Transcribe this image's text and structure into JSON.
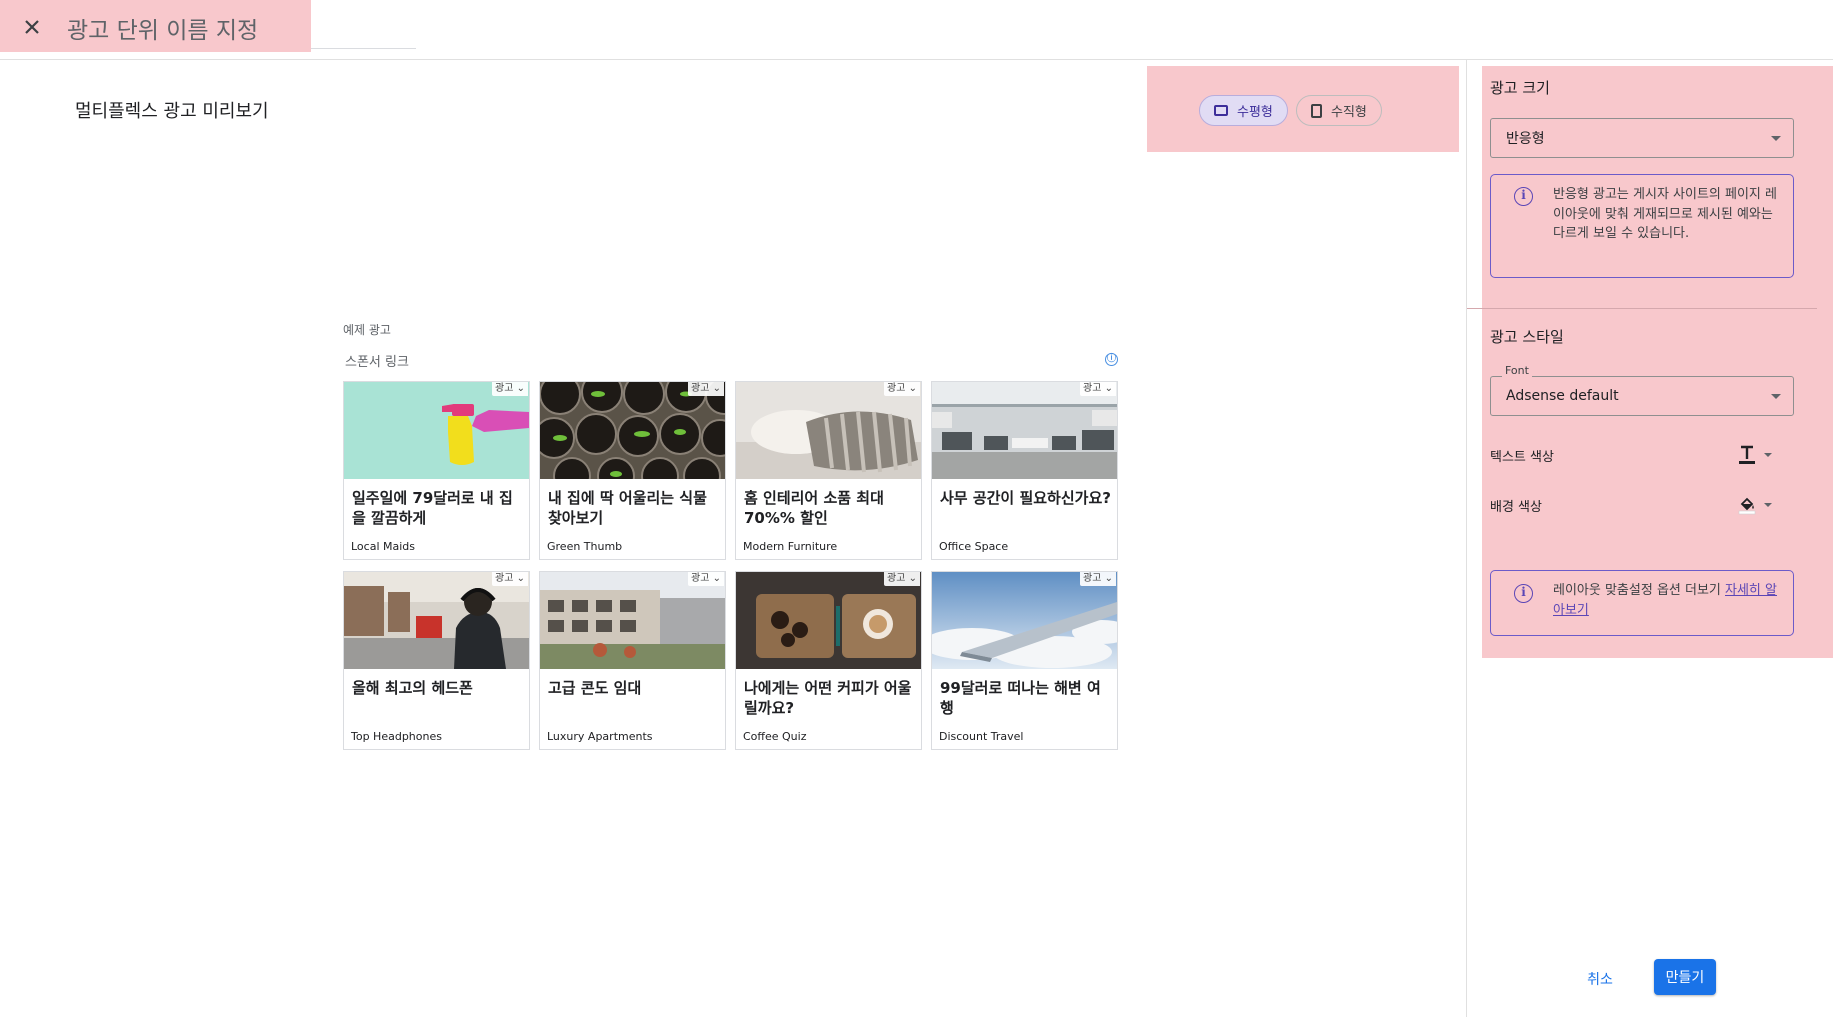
{
  "header": {
    "title": "광고 단위 이름 지정",
    "close_icon": "close-icon"
  },
  "preview": {
    "title": "멀티플렉스 광고 미리보기",
    "orientation": [
      {
        "label": "수평형",
        "active": true,
        "icon": "landscape-icon"
      },
      {
        "label": "수직형",
        "active": false,
        "icon": "portrait-icon"
      }
    ]
  },
  "ad_widget": {
    "caption": "예제 광고",
    "sponsored_label": "스폰서 링크",
    "info_icon": "ⓘ",
    "cards": [
      {
        "tag": "광고",
        "headline": "일주일에 79달러로 내 집을 깔끔하게",
        "advertiser": "Local Maids",
        "image": "cleaning-spray"
      },
      {
        "tag": "광고",
        "headline": "내 집에 딱 어울리는 식물 찾아보기",
        "advertiser": "Green Thumb",
        "image": "seedling-pots"
      },
      {
        "tag": "광고",
        "headline": "홈 인테리어 소품 최대 70%% 할인",
        "advertiser": "Modern Furniture",
        "image": "pillows"
      },
      {
        "tag": "광고",
        "headline": "사무 공간이 필요하신가요?",
        "advertiser": "Office Space",
        "image": "office"
      },
      {
        "tag": "광고",
        "headline": "올해 최고의 헤드폰",
        "advertiser": "Top Headphones",
        "image": "street-headphones"
      },
      {
        "tag": "광고",
        "headline": "고급 콘도 임대",
        "advertiser": "Luxury Apartments",
        "image": "apartments"
      },
      {
        "tag": "광고",
        "headline": "나에게는 어떤 커피가 어울릴까요?",
        "advertiser": "Coffee Quiz",
        "image": "coffee"
      },
      {
        "tag": "광고",
        "headline": "99달러로 떠나는 해변 여행",
        "advertiser": "Discount Travel",
        "image": "airplane-wing"
      }
    ]
  },
  "panel": {
    "ad_size": {
      "title": "광고 크기",
      "select_value": "반응형",
      "note": "반응형 광고는 게시자 사이트의 페이지 레이아웃에 맞춰 게재되므로 제시된 예와는 다르게 보일 수 있습니다."
    },
    "ad_style": {
      "title": "광고 스타일",
      "font_label": "Font",
      "font_value": "Adsense default",
      "text_color_label": "텍스트 색상",
      "bg_color_label": "배경 색상",
      "note_text": "레이아웃 맞춤설정 옵션 더보기 ",
      "note_link": "자세히 알아보기"
    }
  },
  "footer": {
    "cancel_label": "취소",
    "create_label": "만들기"
  },
  "colors": {
    "accent": "#1a73e8",
    "highlight": "#f8c8cc",
    "purple": "#5b46b6"
  }
}
